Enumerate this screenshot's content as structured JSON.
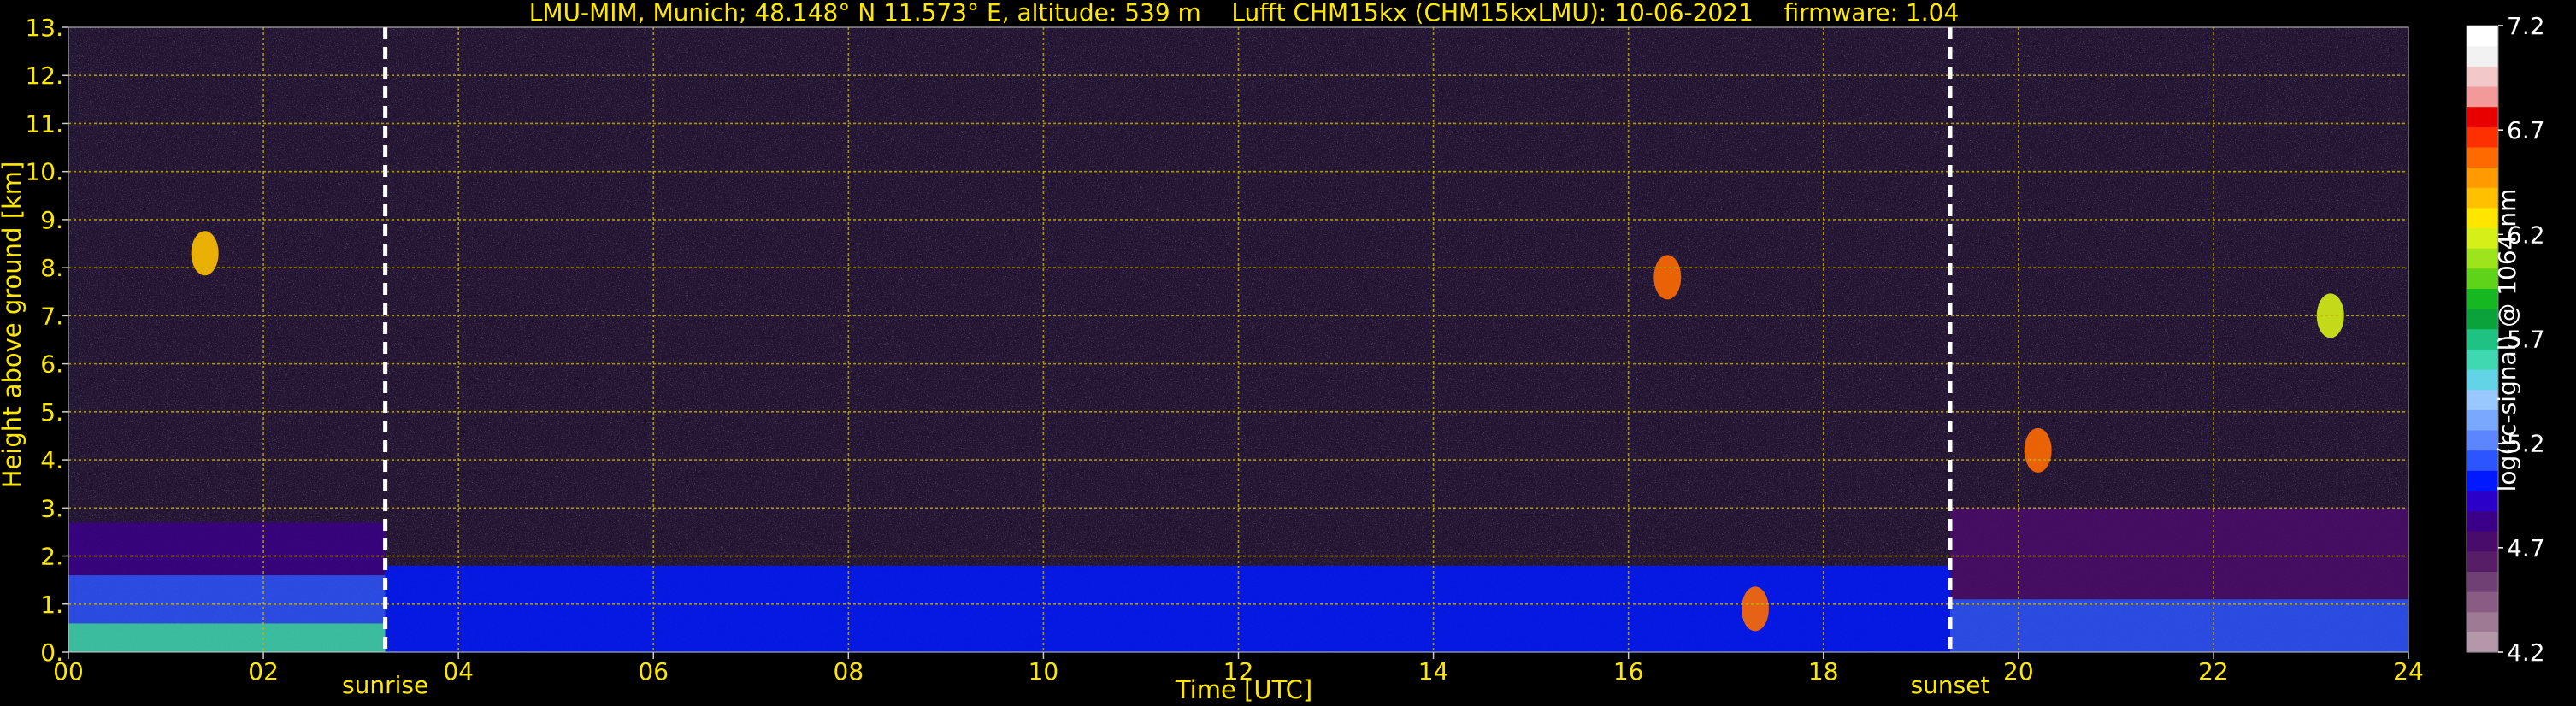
{
  "chart_data": {
    "type": "heatmap",
    "title": "LMU-MIM, Munich; 48.148° N 11.573° E, altitude: 539 m    Lufft CHM15kx (CHM15kxLMU): 10-06-2021    firmware: 1.04",
    "xlabel": "Time [UTC]",
    "ylabel": "Height above ground [km]",
    "xlim": [
      0,
      24
    ],
    "ylim": [
      0,
      13
    ],
    "x_ticks": [
      "00",
      "02",
      "04",
      "06",
      "08",
      "10",
      "12",
      "14",
      "16",
      "18",
      "20",
      "22",
      "24"
    ],
    "y_ticks": [
      "0.",
      "1.",
      "2.",
      "3.",
      "4.",
      "5.",
      "6.",
      "7.",
      "8.",
      "9.",
      "10.",
      "11.",
      "12.",
      "13."
    ],
    "grid": true,
    "colorbar": {
      "label": "log(rc-signal) @ 1064 nm",
      "range": [
        4.2,
        7.2
      ],
      "ticks": [
        "4.2",
        "4.7",
        "5.2",
        "5.7",
        "6.2",
        "6.7",
        "7.2"
      ],
      "colors": [
        "#b497a8",
        "#9f7a95",
        "#8a5c84",
        "#703f74",
        "#571e67",
        "#4a0c6a",
        "#3b0088",
        "#2b00c8",
        "#0019ff",
        "#2d55ff",
        "#5b86ff",
        "#7ba8ff",
        "#99c8ff",
        "#63d3e6",
        "#3fd8b0",
        "#1ec383",
        "#0aa23a",
        "#15b820",
        "#5fd21a",
        "#9de41c",
        "#d5f018",
        "#ffe600",
        "#ffc000",
        "#ff9a00",
        "#ff6a00",
        "#ff3000",
        "#e80000",
        "#f29a9a",
        "#f2c8c8",
        "#f2f2f2",
        "#ffffff"
      ]
    },
    "annotations": [
      {
        "text": "sunrise",
        "x": 3.25
      },
      {
        "text": "sunset",
        "x": 19.3
      }
    ],
    "layers": [
      {
        "x0": 0.0,
        "x1": 3.25,
        "y0": 0.0,
        "y1": 0.6,
        "value": 5.6
      },
      {
        "x0": 0.0,
        "x1": 3.25,
        "y0": 0.6,
        "y1": 1.6,
        "value": 5.15
      },
      {
        "x0": 0.0,
        "x1": 3.25,
        "y0": 1.6,
        "y1": 2.7,
        "value": 4.8
      },
      {
        "x0": 3.25,
        "x1": 19.3,
        "y0": 0.0,
        "y1": 1.8,
        "value": 5.05
      },
      {
        "x0": 19.3,
        "x1": 24.0,
        "y0": 0.0,
        "y1": 1.1,
        "value": 5.1
      },
      {
        "x0": 19.3,
        "x1": 24.0,
        "y0": 1.1,
        "y1": 3.0,
        "value": 4.75
      }
    ],
    "features": [
      {
        "x": 1.4,
        "y": 8.3,
        "value": 6.4
      },
      {
        "x": 16.4,
        "y": 7.8,
        "value": 6.6
      },
      {
        "x": 17.3,
        "y": 0.9,
        "value": 6.6
      },
      {
        "x": 20.2,
        "y": 4.2,
        "value": 6.6
      },
      {
        "x": 23.2,
        "y": 7.0,
        "value": 6.2
      }
    ]
  }
}
